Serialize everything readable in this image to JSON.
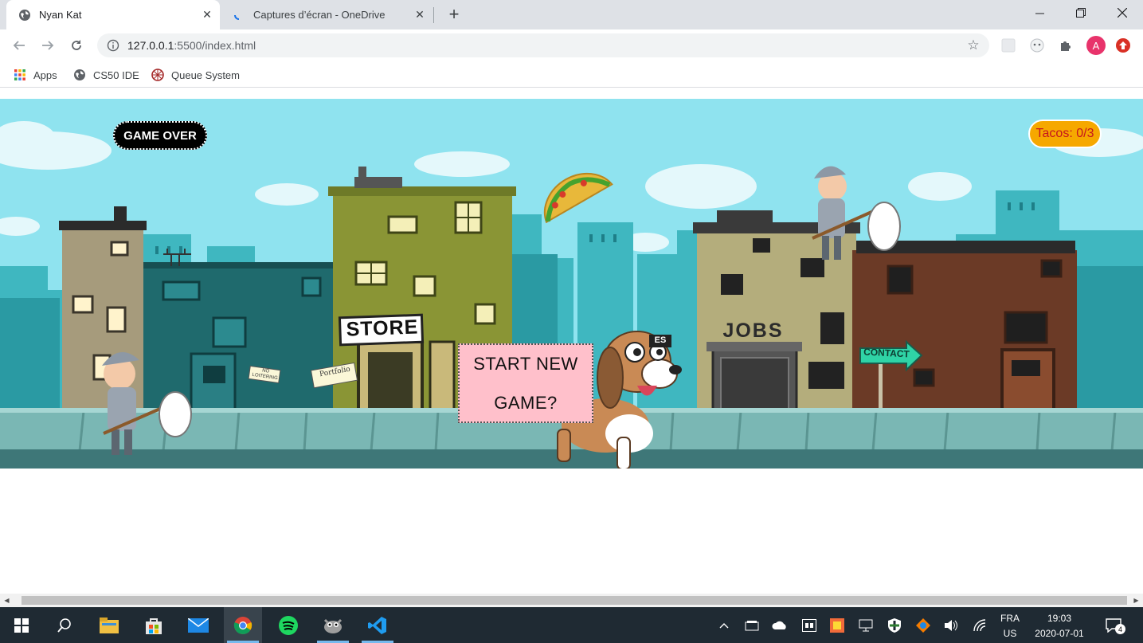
{
  "browser": {
    "tabs": [
      {
        "title": "Nyan Kat",
        "icon": "globe-icon",
        "active": true
      },
      {
        "title": "Captures d’écran - OneDrive",
        "icon": "onedrive-loading-icon",
        "active": false
      }
    ],
    "url_host": "127.0.0.1",
    "url_rest": ":5500/index.html",
    "bookmarks": [
      {
        "label": "Apps",
        "icon": "apps-grid-icon"
      },
      {
        "label": "CS50 IDE",
        "icon": "globe-icon"
      },
      {
        "label": "Queue System",
        "icon": "queue-wheel-icon"
      }
    ],
    "profile_initial": "A"
  },
  "game": {
    "status": "GAME OVER",
    "tacos": "Tacos: 0/3",
    "start_line1": "START NEW",
    "start_line2": "GAME?",
    "signs": {
      "store": "STORE",
      "jobs": "JOBS",
      "contact": "CONTACT",
      "portfolio": "Portfolio",
      "no_loitering": "NO LOITERING",
      "hidden_sign": "ES"
    }
  },
  "taskbar": {
    "lang_top": "FRA",
    "lang_bottom": "US",
    "time": "19:03",
    "date": "2020-07-01",
    "notifications": "4"
  },
  "colors": {
    "sky": "#8fe3ef",
    "tacos_badge": "#f6a800",
    "tacos_text": "#c5161d",
    "start_box": "#ffc0cb",
    "taskbar": "#1f2a33"
  }
}
